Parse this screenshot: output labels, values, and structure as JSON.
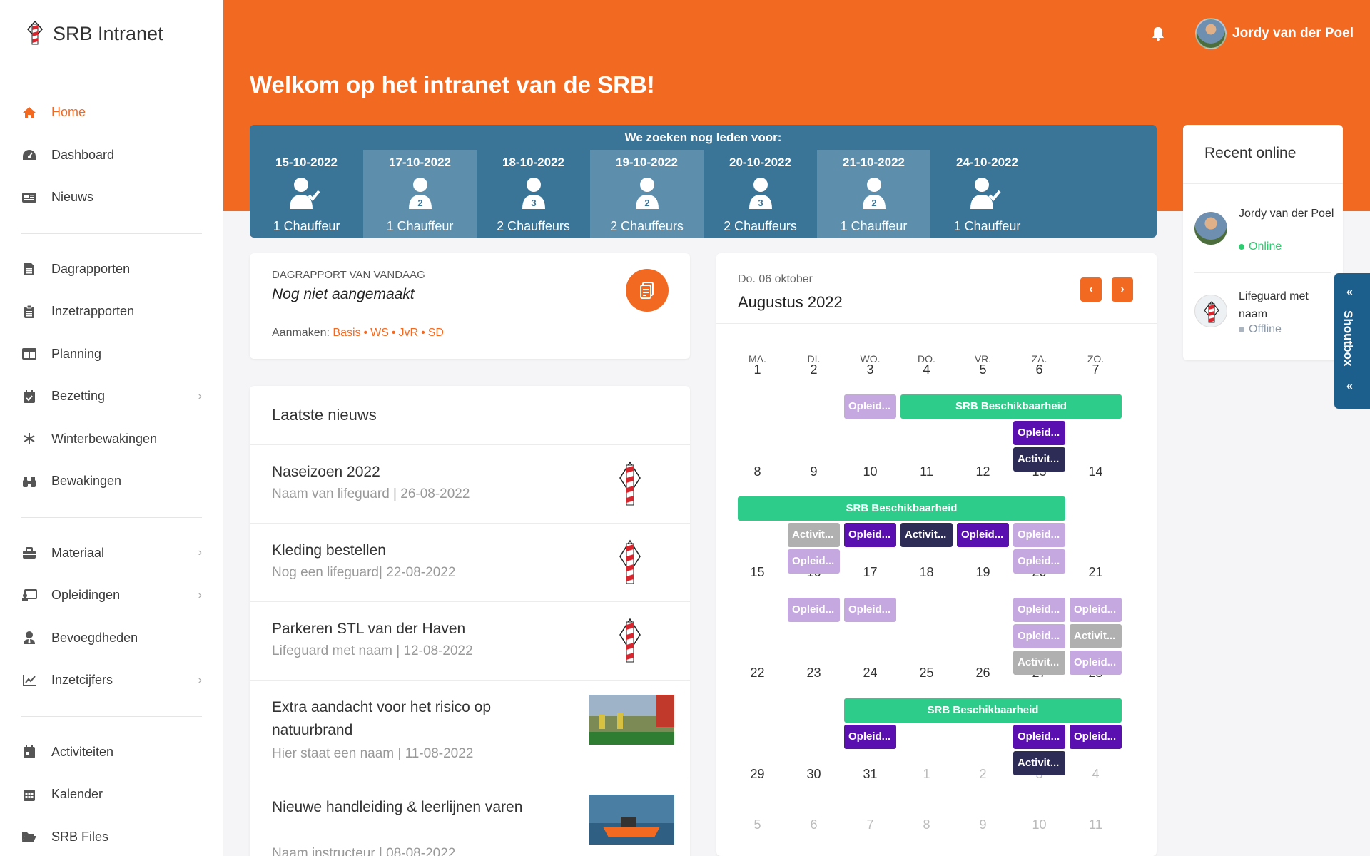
{
  "brand": {
    "name": "SRB Intranet"
  },
  "sidebar": {
    "groups": [
      [
        {
          "label": "Home",
          "icon": "home-icon",
          "active": true
        },
        {
          "label": "Dashboard",
          "icon": "gauge-icon"
        },
        {
          "label": "Nieuws",
          "icon": "newspaper-icon"
        }
      ],
      [
        {
          "label": "Dagrapporten",
          "icon": "file-icon"
        },
        {
          "label": "Inzetrapporten",
          "icon": "clipboard-icon"
        },
        {
          "label": "Planning",
          "icon": "columns-icon"
        },
        {
          "label": "Bezetting",
          "icon": "calendar-check-icon",
          "chevron": true
        },
        {
          "label": "Winterbewakingen",
          "icon": "snowflake-icon"
        },
        {
          "label": "Bewakingen",
          "icon": "binoculars-icon"
        }
      ],
      [
        {
          "label": "Materiaal",
          "icon": "toolbox-icon",
          "chevron": true
        },
        {
          "label": "Opleidingen",
          "icon": "chalkboard-icon",
          "chevron": true
        },
        {
          "label": "Bevoegdheden",
          "icon": "user-tie-icon"
        },
        {
          "label": "Inzetcijfers",
          "icon": "chart-line-icon",
          "chevron": true
        }
      ],
      [
        {
          "label": "Activiteiten",
          "icon": "calendar-icon"
        },
        {
          "label": "Kalender",
          "icon": "calendar-grid-icon"
        },
        {
          "label": "SRB Files",
          "icon": "folder-open-icon"
        }
      ]
    ]
  },
  "header": {
    "user_name": "Jordy van der Poel",
    "welcome": "Welkom op het intranet van de SRB!"
  },
  "shifts": {
    "title": "We zoeken nog leden voor:",
    "items": [
      {
        "date": "15-10-2022",
        "count": "",
        "label": "1 Chauffeur",
        "check": true
      },
      {
        "date": "17-10-2022",
        "count": "2",
        "label": "1 Chauffeur"
      },
      {
        "date": "18-10-2022",
        "count": "3",
        "label": "2 Chauffeurs"
      },
      {
        "date": "19-10-2022",
        "count": "2",
        "label": "2 Chauffeurs"
      },
      {
        "date": "20-10-2022",
        "count": "3",
        "label": "2 Chauffeurs"
      },
      {
        "date": "21-10-2022",
        "count": "2",
        "label": "1 Chauffeur"
      },
      {
        "date": "24-10-2022",
        "count": "",
        "label": "1 Chauffeur",
        "check": true
      }
    ]
  },
  "dagrapport": {
    "overline": "Dagrapport van vandaag",
    "status": "Nog niet aangemaakt",
    "create_label": "Aanmaken:",
    "links": [
      "Basis",
      "WS",
      "JvR",
      "SD"
    ]
  },
  "news": {
    "title": "Laatste nieuws",
    "items": [
      {
        "title": "Naseizoen 2022",
        "meta": "Naam van lifeguard  |  26-08-2022",
        "thumb": "logo"
      },
      {
        "title": "Kleding bestellen",
        "meta": "Nog een lifeguard|  22-08-2022",
        "thumb": "logo"
      },
      {
        "title": "Parkeren STL van der Haven",
        "meta": "Lifeguard met naam  |  12-08-2022",
        "thumb": "logo"
      },
      {
        "title": "Extra aandacht voor het risico op natuurbrand",
        "meta": "Hier staat een naam  |  11-08-2022",
        "thumb": "fire"
      },
      {
        "title": "Nieuwe handleiding & leerlijnen varen",
        "meta": "Naam instructeur  |  08-08-2022",
        "thumb": "boat"
      }
    ]
  },
  "calendar": {
    "today_label": "Do. 06 oktober",
    "month_label": "Augustus 2022",
    "weekdays": [
      "MA.",
      "DI.",
      "WO.",
      "DO.",
      "VR.",
      "ZA.",
      "ZO."
    ],
    "weeks": [
      [
        "1",
        "2",
        "3",
        "4",
        "5",
        "6",
        "7"
      ],
      [
        "8",
        "9",
        "10",
        "11",
        "12",
        "13",
        "14"
      ],
      [
        "15",
        "16",
        "17",
        "18",
        "19",
        "20",
        "21"
      ],
      [
        "22",
        "23",
        "24",
        "25",
        "26",
        "27",
        "28"
      ],
      [
        "29",
        "30",
        "31",
        "1",
        "2",
        "3",
        "4"
      ],
      [
        "5",
        "6",
        "7",
        "8",
        "9",
        "10",
        "11"
      ]
    ],
    "event_texts": {
      "opl": "Opleid...",
      "act": "Activit...",
      "srb": "SRB Beschikbaarheid"
    }
  },
  "recent_online": {
    "title": "Recent online",
    "users": [
      {
        "name": "Jordy van der Poel",
        "status": "Online",
        "color": "#2ecc71"
      },
      {
        "name": "Lifeguard met naam",
        "status": "Offline",
        "color": "#aab4bf"
      }
    ]
  },
  "shoutbox": {
    "label": "Shoutbox"
  },
  "colors": {
    "accent": "#f26a22",
    "strip": "#3a7497",
    "srb": "#2ecc8a"
  }
}
